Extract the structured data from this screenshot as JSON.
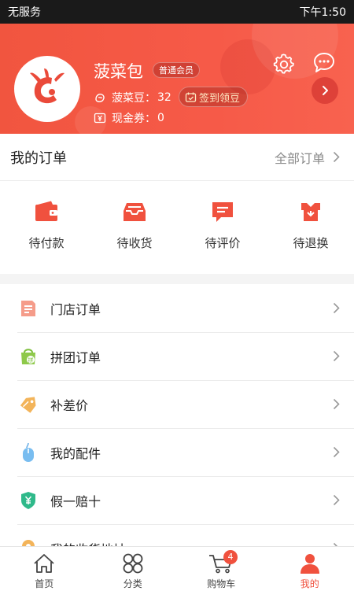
{
  "status_bar": {
    "carrier": "无服务",
    "time": "下午1:50"
  },
  "profile": {
    "username": "菠菜包",
    "member_level": "普通会员",
    "beans_label": "菠菜豆：",
    "beans_value": "32",
    "signin_label": "签到领豆",
    "coupon_label": "现金券：",
    "coupon_value": "0"
  },
  "orders": {
    "title": "我的订单",
    "all_label": "全部订单",
    "states": [
      {
        "label": "待付款",
        "icon": "wallet-icon"
      },
      {
        "label": "待收货",
        "icon": "inbox-icon"
      },
      {
        "label": "待评价",
        "icon": "comment-icon"
      },
      {
        "label": "待退换",
        "icon": "return-icon"
      }
    ]
  },
  "menu": [
    {
      "label": "门店订单",
      "icon": "store-order-icon"
    },
    {
      "label": "拼团订单",
      "icon": "group-buy-icon"
    },
    {
      "label": "补差价",
      "icon": "price-tag-icon"
    },
    {
      "label": "我的配件",
      "icon": "mouse-icon"
    },
    {
      "label": "假一赔十",
      "icon": "shield-yen-icon"
    },
    {
      "label": "我的收货地址",
      "icon": "location-icon"
    }
  ],
  "bottom_nav": [
    {
      "label": "首页",
      "icon": "home-icon"
    },
    {
      "label": "分类",
      "icon": "category-icon"
    },
    {
      "label": "购物车",
      "icon": "cart-icon",
      "badge": "4"
    },
    {
      "label": "我的",
      "icon": "user-icon",
      "active": true
    }
  ],
  "colors": {
    "accent": "#f0513e",
    "header_start": "#f1553f",
    "header_end": "#f8624f"
  }
}
